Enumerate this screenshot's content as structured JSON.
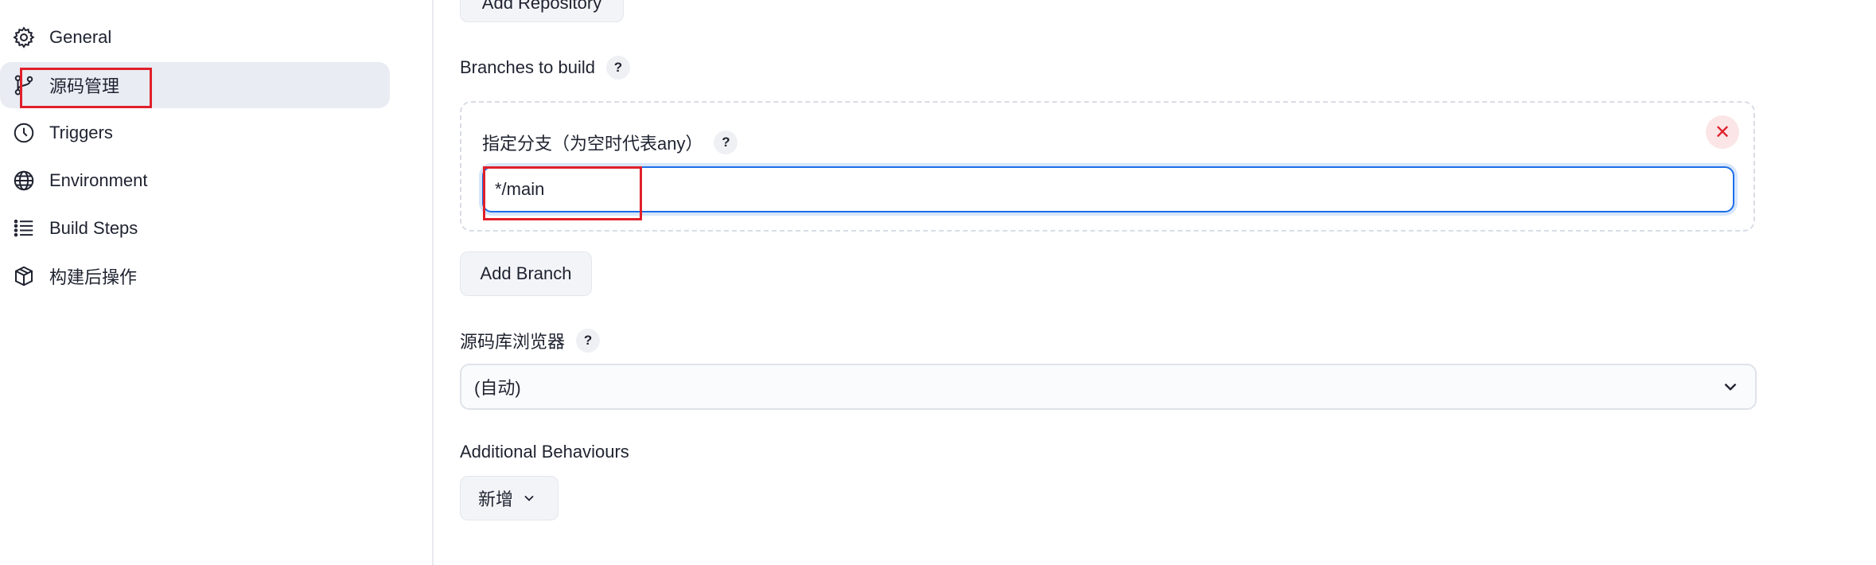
{
  "sidebar": {
    "items": [
      {
        "label": "General",
        "icon": "gear-icon"
      },
      {
        "label": "源码管理",
        "icon": "source-branch-icon",
        "active": true
      },
      {
        "label": "Triggers",
        "icon": "clock-icon"
      },
      {
        "label": "Environment",
        "icon": "globe-icon"
      },
      {
        "label": "Build Steps",
        "icon": "list-icon"
      },
      {
        "label": "构建后操作",
        "icon": "package-icon"
      }
    ]
  },
  "main": {
    "add_repository_label": "Add Repository",
    "branches_to_build_label": "Branches to build",
    "help_label": "?",
    "branch_spec_label": "指定分支（为空时代表any）",
    "branch_spec_value": "*/main",
    "close_glyph": "✕",
    "add_branch_label": "Add Branch",
    "repo_browser_label": "源码库浏览器",
    "repo_browser_value": "(自动)",
    "additional_behaviours_label": "Additional Behaviours",
    "add_new_label": "新增"
  },
  "colors": {
    "accent_blue": "#1d6ee8",
    "highlight_red": "#e0202a",
    "active_bg": "#e9ecf3"
  }
}
